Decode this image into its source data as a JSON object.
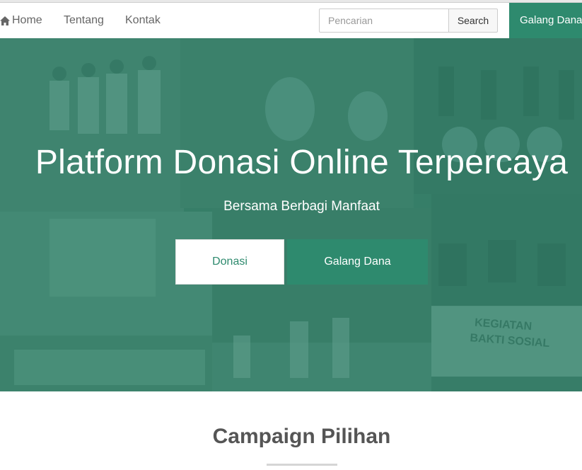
{
  "nav": {
    "home_label": "Home",
    "tentang_label": "Tentang",
    "kontak_label": "Kontak",
    "search_placeholder": "Pencarian",
    "search_value": "",
    "search_button": "Search",
    "galang_label": "Galang Dana"
  },
  "hero": {
    "title": "Platform Donasi Online Terpercaya",
    "subtitle": "Bersama Berbagi Manfaat",
    "donasi_button": "Donasi",
    "galang_button": "Galang Dana",
    "banner_text": "KEGIATAN BAKTI SOSIAL"
  },
  "section": {
    "title": "Campaign Pilihan"
  },
  "colors": {
    "brand": "#2e8a6e",
    "overlay": "#288066"
  },
  "icons": {
    "home": "home-icon"
  }
}
